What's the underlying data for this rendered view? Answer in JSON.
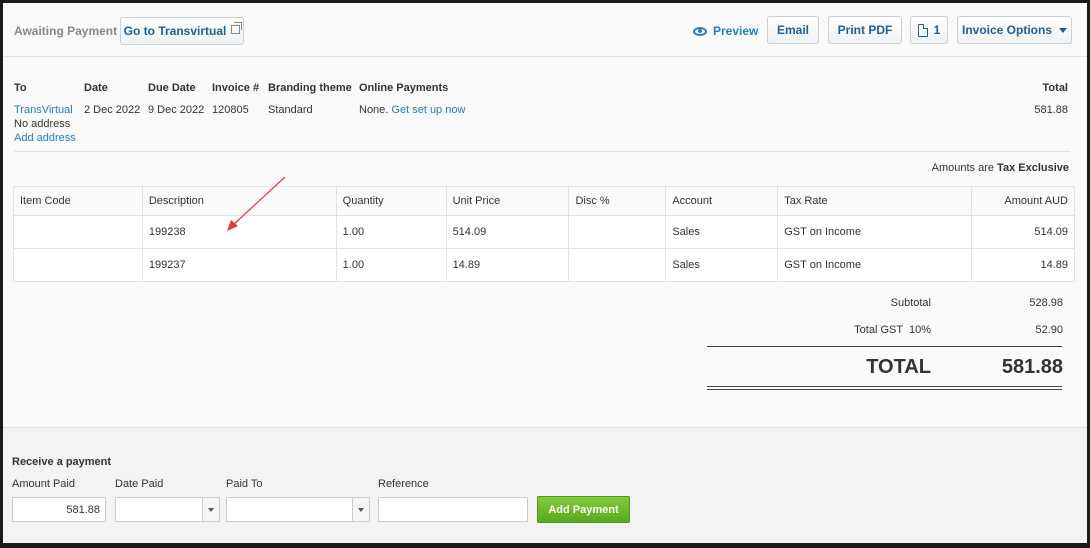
{
  "toolbar": {
    "status": "Awaiting Payment",
    "goto_label": "Go to Transvirtual",
    "preview_label": "Preview",
    "email_label": "Email",
    "print_pdf_label": "Print PDF",
    "copies_count": "1",
    "invoice_options_label": "Invoice Options"
  },
  "header": {
    "to_label": "To",
    "date_label": "Date",
    "due_label": "Due Date",
    "invoice_label": "Invoice #",
    "branding_label": "Branding theme",
    "online_label": "Online Payments",
    "total_label": "Total",
    "to_name": "TransVirtual",
    "no_address": "No address",
    "add_address": "Add address",
    "date": "2 Dec 2022",
    "due_date": "9 Dec 2022",
    "invoice_no": "120805",
    "branding": "Standard",
    "online_none": "None.",
    "online_setup": "Get set up now",
    "total": "581.88"
  },
  "amounts_are": {
    "prefix": "Amounts are",
    "value": "Tax Exclusive"
  },
  "table": {
    "headers": [
      "Item Code",
      "Description",
      "Quantity",
      "Unit Price",
      "Disc %",
      "Account",
      "Tax Rate",
      "Amount AUD"
    ],
    "rows": [
      {
        "item_code": "",
        "description": "199238",
        "quantity": "1.00",
        "unit_price": "514.09",
        "disc": "",
        "account": "Sales",
        "tax_rate": "GST on Income",
        "amount": "514.09"
      },
      {
        "item_code": "",
        "description": "199237",
        "quantity": "1.00",
        "unit_price": "14.89",
        "disc": "",
        "account": "Sales",
        "tax_rate": "GST on Income",
        "amount": "14.89"
      }
    ]
  },
  "totals": {
    "subtotal_label": "Subtotal",
    "subtotal": "528.98",
    "gst_label": "Total GST  10%",
    "gst": "52.90",
    "total_label": "TOTAL",
    "total": "581.88"
  },
  "payment": {
    "title": "Receive a payment",
    "amount_label": "Amount Paid",
    "date_label": "Date Paid",
    "paid_to_label": "Paid To",
    "reference_label": "Reference",
    "amount_value": "581.88",
    "date_value": "",
    "paid_to_value": "",
    "reference_value": "",
    "add_label": "Add Payment"
  },
  "colors": {
    "link": "#1f7fbf",
    "button_text": "#1f5e96",
    "add_button": "#5aa91e",
    "annotation_arrow": "#e03a3a"
  }
}
